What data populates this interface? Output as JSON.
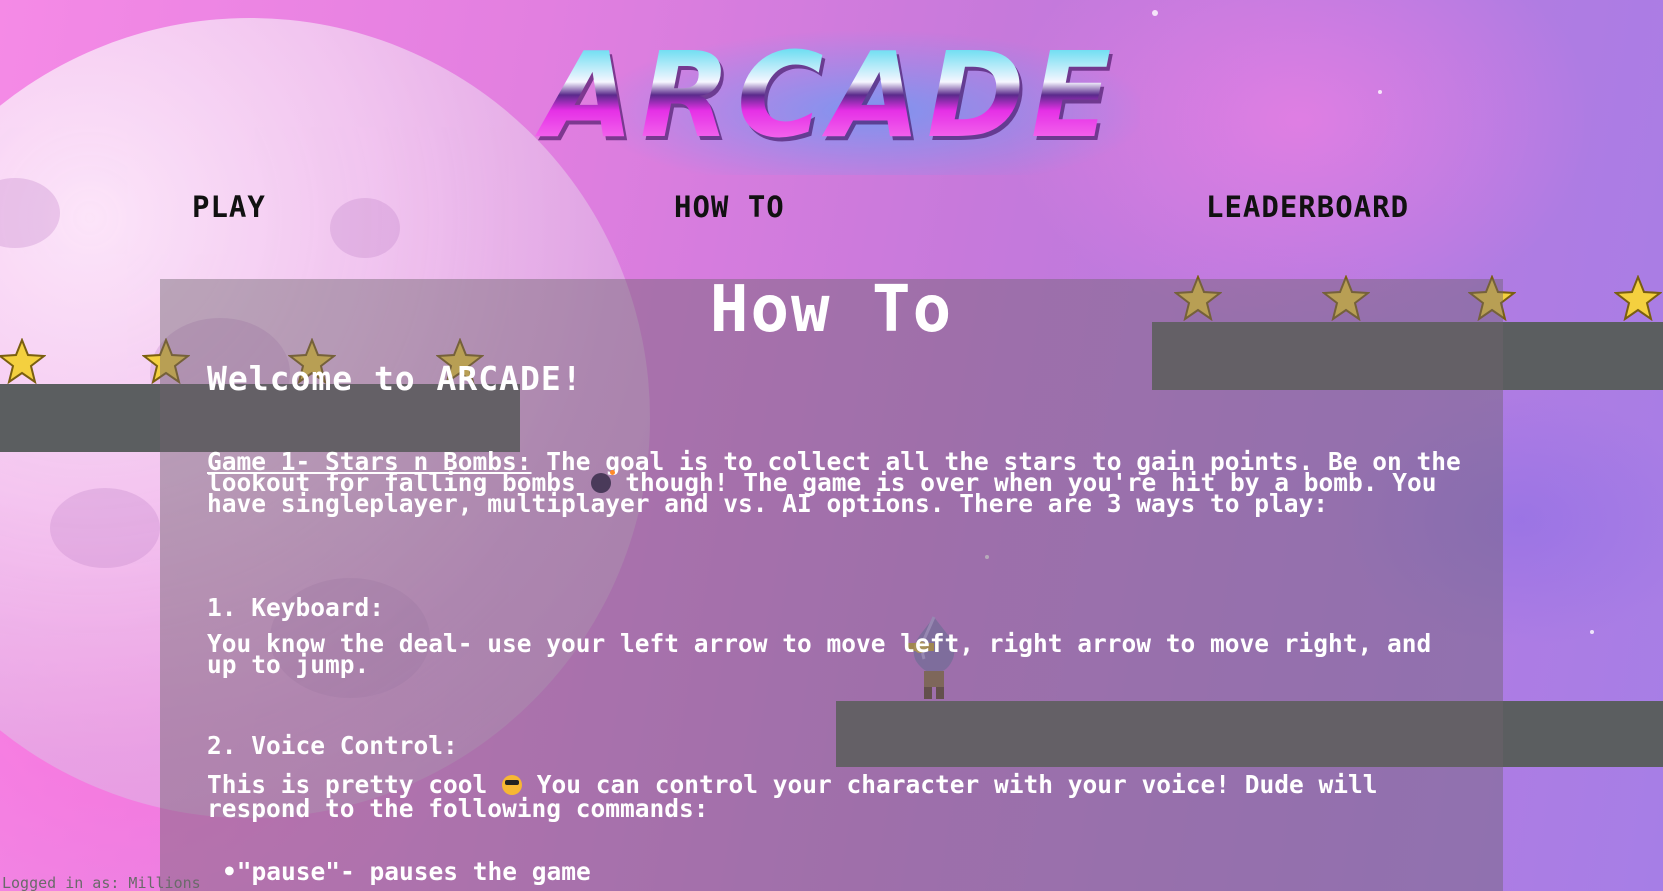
{
  "app": {
    "logo_text": "ARCADE"
  },
  "nav": {
    "items": [
      {
        "label": "PLAY"
      },
      {
        "label": "HOW TO"
      },
      {
        "label": "LEADERBOARD"
      }
    ]
  },
  "howto": {
    "title": "How To",
    "welcome": "Welcome to ARCADE!",
    "game1_title": "Game 1- Stars n Bombs:",
    "game1_text_a": " The goal is to collect all the stars to gain points. Be on the lookout for falling bombs ",
    "game1_text_b": " though! The game is over when you're hit by a bomb. You have singleplayer, multiplayer and vs. AI options. There are 3 ways to play:",
    "keyboard_heading": "1. Keyboard:",
    "keyboard_text": "You know the deal- use your left arrow to move left, right arrow to move right, and up to jump.",
    "voice_heading": "2. Voice Control:",
    "voice_text_a": "This is pretty cool ",
    "voice_text_b": " You can control your character with your voice! Dude will respond to the following commands:",
    "commands": [
      "\"pause\"- pauses the game"
    ]
  },
  "footer": {
    "logged_in_text": "Logged in as: Millions"
  },
  "icons": {
    "star": "star-icon",
    "bomb": "bomb-emoji",
    "cool": "cool-face-emoji"
  },
  "colors": {
    "panel_text": "#ffffff",
    "nav_text": "#111111",
    "platform": "#5b5e60",
    "star": "#f4d03f"
  }
}
